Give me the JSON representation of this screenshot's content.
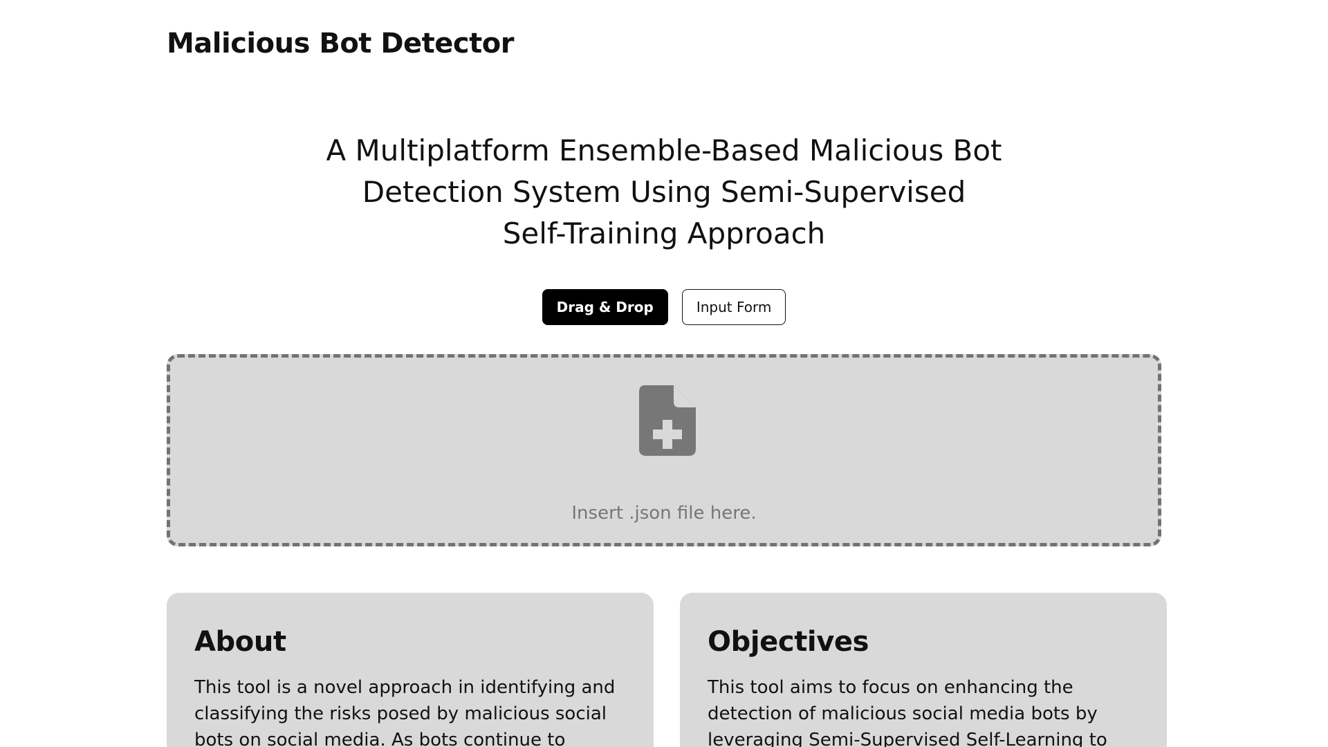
{
  "header": {
    "app_title": "Malicious Bot Detector"
  },
  "hero": {
    "title": "A Multiplatform Ensemble-Based Malicious Bot\nDetection System Using Semi-Supervised\nSelf-Training Approach"
  },
  "mode_toggle": {
    "drag_drop_label": "Drag & Drop",
    "input_form_label": "Input Form",
    "selected": "Drag & Drop"
  },
  "dropzone": {
    "icon": "file-plus-icon",
    "prompt": "Insert .json file here."
  },
  "cards": {
    "about": {
      "title": "About",
      "body": "This tool is a novel approach in identifying and\nclassifying the risks posed by malicious social\nbots on social media. As bots continue to evolve"
    },
    "objectives": {
      "title": "Objectives",
      "body": "This tool aims to focus on enhancing the\ndetection of malicious social media bots by\nleveraging Semi-Supervised Self-Learning to"
    }
  },
  "colors": {
    "background": "#ffffff",
    "panel": "#d9d9d9",
    "dashed_border": "#727272",
    "icon": "#777777",
    "primary_button": "#000000",
    "text": "#111111"
  }
}
